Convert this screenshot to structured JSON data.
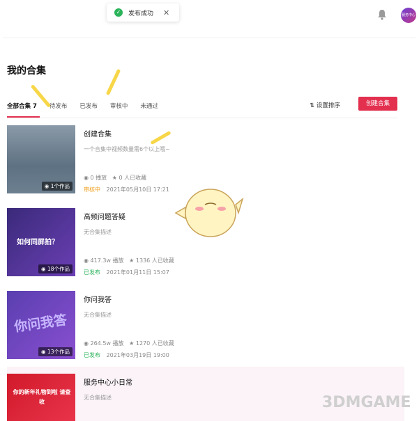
{
  "toast": {
    "message": "发布成功",
    "close": "✕"
  },
  "header": {
    "avatar_text": "服务中心"
  },
  "page": {
    "title": "我的合集",
    "tabs": [
      "全部合集 7",
      "待发布",
      "已发布",
      "审核中",
      "未通过"
    ],
    "sort_label": "⇅ 设置排序",
    "create_label": "创建合集"
  },
  "items": [
    {
      "name": "创建合集",
      "desc": "一个合集中视频数量需6个以上哦~",
      "plays": "◉ 0 播放",
      "favs": "★ 0 人已收藏",
      "status": "审核中",
      "date": "2021年05月10日 17:21",
      "count": "◉ 1个作品"
    },
    {
      "name": "高频问题答疑",
      "desc": "无合集描述",
      "plays": "◉ 417.3w 播放",
      "favs": "★ 1336 人已收藏",
      "status": "已发布",
      "date": "2021年01月11日 15:07",
      "count": "◉ 18个作品",
      "thumb_text": "如何同屏拍？"
    },
    {
      "name": "你问我答",
      "desc": "无合集描述",
      "plays": "◉ 264.5w 播放",
      "favs": "★ 1270 人已收藏",
      "status": "已发布",
      "date": "2021年03月19日 19:00",
      "count": "◉ 13个作品",
      "thumb_text": "你问我答"
    },
    {
      "name": "服务中心小日常",
      "desc": "无合集描述",
      "thumb_text": "你的新年礼物到啦 请查收"
    }
  ],
  "watermark": "3DMGAME"
}
